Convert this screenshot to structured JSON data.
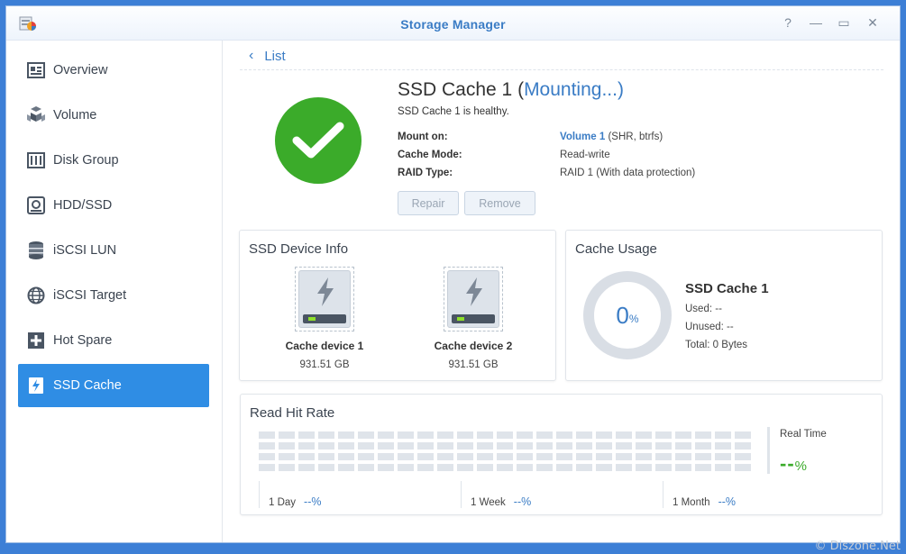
{
  "window": {
    "title": "Storage Manager",
    "controls": [
      "?",
      "—",
      "▭",
      "✕"
    ]
  },
  "sidebar": {
    "items": [
      {
        "label": "Overview",
        "icon": "overview-icon",
        "active": false
      },
      {
        "label": "Volume",
        "icon": "volume-icon",
        "active": false
      },
      {
        "label": "Disk Group",
        "icon": "disk-group-icon",
        "active": false
      },
      {
        "label": "HDD/SSD",
        "icon": "hdd-ssd-icon",
        "active": false
      },
      {
        "label": "iSCSI LUN",
        "icon": "iscsi-lun-icon",
        "active": false
      },
      {
        "label": "iSCSI Target",
        "icon": "iscsi-target-icon",
        "active": false
      },
      {
        "label": "Hot Spare",
        "icon": "hot-spare-icon",
        "active": false
      },
      {
        "label": "SSD Cache",
        "icon": "ssd-cache-icon",
        "active": true
      }
    ]
  },
  "header": {
    "back_label": "List",
    "title_main": "SSD Cache 1 (",
    "title_status": "Mounting...",
    "title_close": ")",
    "health_text": "SSD Cache 1 is healthy.",
    "mount_on_label": "Mount on:",
    "mount_on_link": "Volume 1",
    "mount_on_detail": " (SHR, btrfs)",
    "cache_mode_label": "Cache Mode:",
    "cache_mode_value": "Read-write",
    "raid_type_label": "RAID Type:",
    "raid_type_value": "RAID 1 (With data protection)",
    "repair_label": "Repair",
    "remove_label": "Remove"
  },
  "device_info": {
    "title": "SSD Device Info",
    "devices": [
      {
        "name": "Cache device 1",
        "size": "931.51 GB"
      },
      {
        "name": "Cache device 2",
        "size": "931.51 GB"
      }
    ]
  },
  "cache_usage": {
    "title": "Cache Usage",
    "percent": "0",
    "percent_unit": "%",
    "name": "SSD Cache 1",
    "used": "Used: --",
    "unused": "Unused: --",
    "total": "Total: 0 Bytes"
  },
  "read_hit_rate": {
    "title": "Read Hit Rate",
    "realtime_label": "Real Time",
    "realtime_value": "--",
    "realtime_unit": "%",
    "periods": [
      {
        "label": "1 Day",
        "value": "--%"
      },
      {
        "label": "1 Week",
        "value": "--%"
      },
      {
        "label": "1 Month",
        "value": "--%"
      }
    ]
  },
  "watermark": "© Diszone.Net",
  "colors": {
    "accent": "#2f8de4",
    "link": "#3a7cc5",
    "healthy": "#3bab2a",
    "background": "#3d7fd6"
  }
}
